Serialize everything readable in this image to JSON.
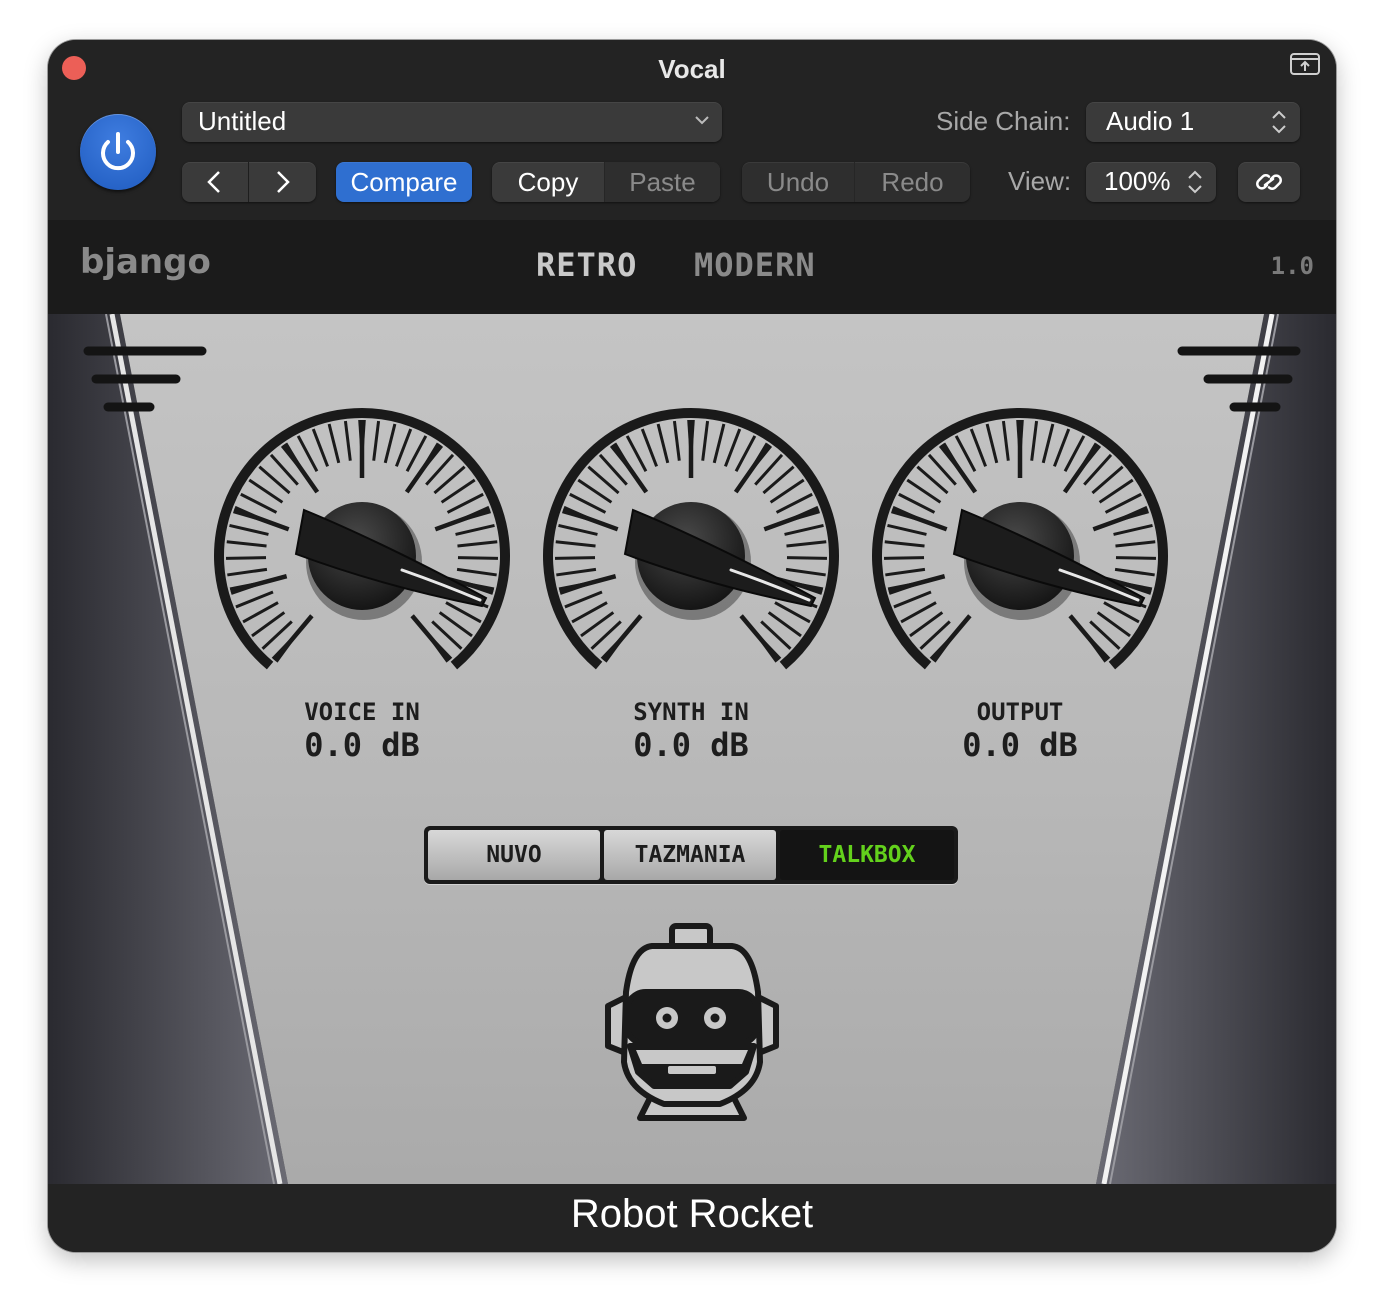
{
  "window": {
    "title": "Vocal"
  },
  "host": {
    "preset_name": "Untitled",
    "side_chain_label": "Side Chain:",
    "side_chain_value": "Audio 1",
    "compare_label": "Compare",
    "copy_label": "Copy",
    "paste_label": "Paste",
    "undo_label": "Undo",
    "redo_label": "Redo",
    "view_label": "View:",
    "view_value": "100%",
    "icons": [
      "power-icon",
      "chevron-left-icon",
      "chevron-right-icon",
      "updown-arrows-icon",
      "link-icon",
      "fold-window-icon"
    ]
  },
  "plugin": {
    "brand": "bjango",
    "modes": [
      "RETRO",
      "MODERN"
    ],
    "active_mode": "RETRO",
    "version": "1.0",
    "knobs": [
      {
        "name": "VOICE IN",
        "value": "0.0 dB"
      },
      {
        "name": "SYNTH IN",
        "value": "0.0 dB"
      },
      {
        "name": "OUTPUT",
        "value": "0.0 dB"
      }
    ],
    "voice_modes": [
      "NUVO",
      "TAZMANIA",
      "TALKBOX"
    ],
    "selected_voice_mode": "TALKBOX",
    "accent_color": "#63d11c"
  },
  "footer": {
    "title": "Robot Rocket"
  }
}
